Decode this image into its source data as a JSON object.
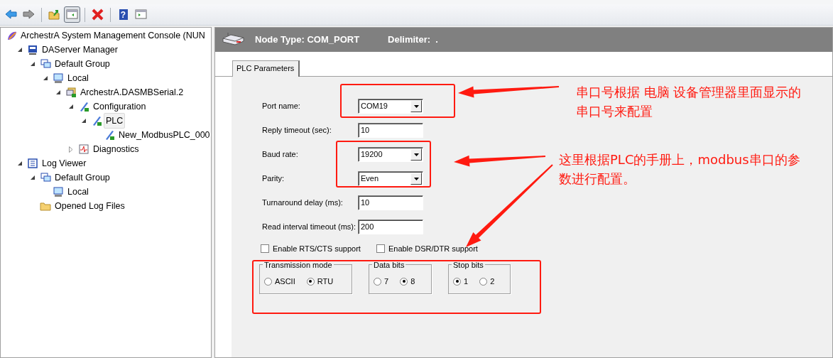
{
  "toolbar": [
    {
      "kind": "back",
      "pressed": false
    },
    {
      "kind": "forward",
      "pressed": false
    },
    {
      "kind": "up",
      "pressed": false
    },
    {
      "kind": "panel",
      "pressed": true
    },
    {
      "kind": "delete",
      "pressed": false
    },
    {
      "kind": "help",
      "pressed": false,
      "glyph": "?"
    },
    {
      "kind": "action-pane",
      "pressed": false
    }
  ],
  "tree": [
    {
      "label": "ArchestrA System Management Console (NUN",
      "kind": "console",
      "selected": false,
      "children": [
        {
          "label": "DAServer Manager",
          "kind": "server",
          "expanded": true,
          "selected": false,
          "children": [
            {
              "label": "Default Group",
              "kind": "group",
              "expanded": true,
              "selected": false,
              "children": [
                {
                  "label": "Local",
                  "kind": "computer",
                  "expanded": true,
                  "selected": false,
                  "children": [
                    {
                      "label": "ArchestrA.DASMBSerial.2",
                      "kind": "daserver",
                      "expanded": true,
                      "selected": false,
                      "children": [
                        {
                          "label": "Configuration",
                          "kind": "pen",
                          "expanded": true,
                          "selected": false,
                          "children": [
                            {
                              "label": "PLC",
                              "kind": "pen",
                              "expanded": true,
                              "selected": true,
                              "children": [
                                {
                                  "label": "New_ModbusPLC_000",
                                  "kind": "pen",
                                  "selected": false
                                }
                              ]
                            }
                          ]
                        },
                        {
                          "label": "Diagnostics",
                          "kind": "chart",
                          "expanded": false,
                          "selected": false
                        }
                      ]
                    }
                  ]
                }
              ]
            }
          ]
        },
        {
          "label": "Log Viewer",
          "kind": "log",
          "expanded": true,
          "selected": false,
          "children": [
            {
              "label": "Default Group",
              "kind": "group",
              "expanded": true,
              "selected": false,
              "children": [
                {
                  "label": "Local",
                  "kind": "computer",
                  "selected": false
                }
              ]
            },
            {
              "label": "Opened Log Files",
              "kind": "folder",
              "selected": false
            }
          ]
        }
      ]
    }
  ],
  "header": {
    "node_type": "Node Type: COM_PORT",
    "delimiter": "Delimiter:  ."
  },
  "tabs": [
    {
      "label": "PLC Parameters",
      "selected": true
    }
  ],
  "fields": [
    {
      "label": "Port name:",
      "kind": "combo",
      "value": "COM19"
    },
    {
      "label": "Reply timeout (sec):",
      "kind": "text",
      "value": "10"
    },
    {
      "label": "Baud rate:",
      "kind": "combo",
      "value": "19200"
    },
    {
      "label": "Parity:",
      "kind": "combo",
      "value": "Even"
    },
    {
      "label": "Turnaround delay (ms):",
      "kind": "text",
      "value": "10"
    },
    {
      "label": "Read interval timeout (ms):",
      "kind": "text",
      "value": "200"
    }
  ],
  "checkboxes": [
    {
      "label": "Enable RTS/CTS support",
      "checked": false
    },
    {
      "label": "Enable DSR/DTR support",
      "checked": false
    }
  ],
  "groups": [
    {
      "title": "Transmission mode",
      "options": [
        {
          "label": "ASCII",
          "selected": false
        },
        {
          "label": "RTU",
          "selected": true
        }
      ]
    },
    {
      "title": "Data bits",
      "options": [
        {
          "label": "7",
          "selected": false
        },
        {
          "label": "8",
          "selected": true
        }
      ]
    },
    {
      "title": "Stop bits",
      "options": [
        {
          "label": "1",
          "selected": true
        },
        {
          "label": "2",
          "selected": false
        }
      ]
    }
  ],
  "notes": [
    {
      "text": "串口号根据 电脑 设备管理器里面显示的串口号来配置"
    },
    {
      "text": "这里根据PLC的手册上，modbus串口的参数进行配置。"
    }
  ]
}
